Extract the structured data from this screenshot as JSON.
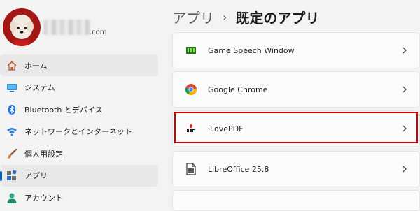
{
  "profile": {
    "email_domain": ".com"
  },
  "nav": {
    "items": [
      {
        "label": "ホーム",
        "icon": "home-icon"
      },
      {
        "label": "システム",
        "icon": "monitor-icon"
      },
      {
        "label": "Bluetooth とデバイス",
        "icon": "bluetooth-icon"
      },
      {
        "label": "ネットワークとインターネット",
        "icon": "wifi-icon"
      },
      {
        "label": "個人用設定",
        "icon": "paintbrush-icon"
      },
      {
        "label": "アプリ",
        "icon": "apps-icon"
      },
      {
        "label": "アカウント",
        "icon": "person-icon"
      }
    ]
  },
  "breadcrumb": {
    "parent": "アプリ",
    "separator": "›",
    "current": "既定のアプリ"
  },
  "apps": [
    {
      "name": "Game Speech Window",
      "icon": "game-speech-icon"
    },
    {
      "name": "Google Chrome",
      "icon": "chrome-icon"
    },
    {
      "name": "iLovePDF",
      "icon": "ilovepdf-icon"
    },
    {
      "name": "LibreOffice 25.8",
      "icon": "libreoffice-icon"
    }
  ],
  "colors": {
    "accent": "#0067c0",
    "highlight": "#d30000"
  }
}
